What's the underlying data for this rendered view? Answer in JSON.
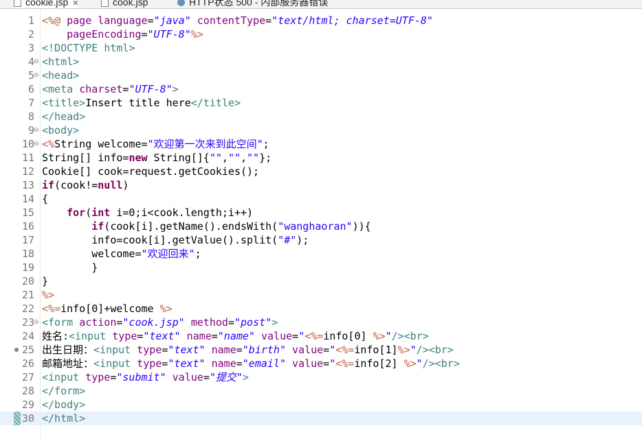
{
  "tabs": [
    {
      "label": "cookie.jsp",
      "close": "✕",
      "active": true
    },
    {
      "label": "cook.jsp",
      "close": "",
      "active": false
    },
    {
      "label": "HTTP状态 500 - 内部服务器错误",
      "close": "",
      "active": false
    }
  ],
  "editor": {
    "current_line": 30,
    "breakpoint_line": 25,
    "lines": [
      {
        "n": "1",
        "fold": "",
        "tokens": [
          [
            "dl",
            "<%@ "
          ],
          [
            "at",
            "page "
          ],
          [
            "at",
            "language"
          ],
          [
            "t",
            "="
          ],
          [
            "av",
            "\"java\""
          ],
          [
            "t",
            " "
          ],
          [
            "at",
            "contentType"
          ],
          [
            "t",
            "="
          ],
          [
            "av",
            "\"text/html; charset=UTF-8\""
          ]
        ]
      },
      {
        "n": "2",
        "fold": "",
        "tokens": [
          [
            "t",
            "    "
          ],
          [
            "at",
            "pageEncoding"
          ],
          [
            "t",
            "="
          ],
          [
            "av",
            "\"UTF-8\""
          ],
          [
            "dl",
            "%>"
          ]
        ]
      },
      {
        "n": "3",
        "fold": "",
        "tokens": [
          [
            "tg",
            "<!DOCTYPE "
          ],
          [
            "tg",
            "html"
          ],
          [
            "tg",
            ">"
          ]
        ]
      },
      {
        "n": "4",
        "fold": "⊖",
        "tokens": [
          [
            "tg",
            "<html>"
          ]
        ]
      },
      {
        "n": "5",
        "fold": "⊖",
        "tokens": [
          [
            "tg",
            "<head>"
          ]
        ]
      },
      {
        "n": "6",
        "fold": "",
        "tokens": [
          [
            "tg",
            "<meta "
          ],
          [
            "at",
            "charset"
          ],
          [
            "t",
            "="
          ],
          [
            "av",
            "\"UTF-8\""
          ],
          [
            "tg",
            ">"
          ]
        ]
      },
      {
        "n": "7",
        "fold": "",
        "tokens": [
          [
            "tg",
            "<title>"
          ],
          [
            "t",
            "Insert title here"
          ],
          [
            "tg",
            "</title>"
          ]
        ]
      },
      {
        "n": "8",
        "fold": "",
        "tokens": [
          [
            "tg",
            "</head>"
          ]
        ]
      },
      {
        "n": "9",
        "fold": "⊖",
        "tokens": [
          [
            "tg",
            "<body>"
          ]
        ]
      },
      {
        "n": "10",
        "fold": "⊖",
        "tokens": [
          [
            "dl",
            "<%"
          ],
          [
            "t",
            "String welcome="
          ],
          [
            "st",
            "\"欢迎第一次来到此空间\""
          ],
          [
            "t",
            ";"
          ]
        ]
      },
      {
        "n": "11",
        "fold": "",
        "tokens": [
          [
            "t",
            "String[] info="
          ],
          [
            "kw",
            "new"
          ],
          [
            "t",
            " String[]{"
          ],
          [
            "st",
            "\"\""
          ],
          [
            "t",
            ","
          ],
          [
            "st",
            "\"\""
          ],
          [
            "t",
            ","
          ],
          [
            "st",
            "\"\""
          ],
          [
            "t",
            "};"
          ]
        ]
      },
      {
        "n": "12",
        "fold": "",
        "tokens": [
          [
            "t",
            "Cookie[] cook=request.getCookies();"
          ]
        ]
      },
      {
        "n": "13",
        "fold": "",
        "tokens": [
          [
            "kw",
            "if"
          ],
          [
            "t",
            "(cook!="
          ],
          [
            "kw",
            "null"
          ],
          [
            "t",
            ")"
          ]
        ]
      },
      {
        "n": "14",
        "fold": "",
        "tokens": [
          [
            "t",
            "{"
          ]
        ]
      },
      {
        "n": "15",
        "fold": "",
        "tokens": [
          [
            "t",
            "    "
          ],
          [
            "kw",
            "for"
          ],
          [
            "t",
            "("
          ],
          [
            "kw",
            "int"
          ],
          [
            "t",
            " i=0;i<cook.length;i++)"
          ]
        ]
      },
      {
        "n": "16",
        "fold": "",
        "tokens": [
          [
            "t",
            "        "
          ],
          [
            "kw",
            "if"
          ],
          [
            "t",
            "(cook[i].getName().endsWith("
          ],
          [
            "st",
            "\"wanghaoran\""
          ],
          [
            "t",
            "))"
          ],
          [
            "t",
            "{"
          ]
        ]
      },
      {
        "n": "17",
        "fold": "",
        "tokens": [
          [
            "t",
            "        info=cook[i].getValue().split("
          ],
          [
            "st",
            "\"#\""
          ],
          [
            "t",
            ");"
          ]
        ]
      },
      {
        "n": "18",
        "fold": "",
        "tokens": [
          [
            "t",
            "        welcome="
          ],
          [
            "st",
            "\"欢迎回来\""
          ],
          [
            "t",
            ";"
          ]
        ]
      },
      {
        "n": "19",
        "fold": "",
        "tokens": [
          [
            "t",
            "        }"
          ]
        ]
      },
      {
        "n": "20",
        "fold": "",
        "tokens": [
          [
            "t",
            "}"
          ]
        ]
      },
      {
        "n": "21",
        "fold": "",
        "tokens": [
          [
            "dl",
            "%>"
          ]
        ]
      },
      {
        "n": "22",
        "fold": "",
        "tokens": [
          [
            "dl",
            "<%="
          ],
          [
            "t",
            "info[0]+welcome "
          ],
          [
            "dl",
            "%>"
          ]
        ]
      },
      {
        "n": "23",
        "fold": "⊖",
        "tokens": [
          [
            "tg",
            "<form "
          ],
          [
            "at",
            "action"
          ],
          [
            "t",
            "="
          ],
          [
            "av",
            "\"cook.jsp\""
          ],
          [
            "t",
            " "
          ],
          [
            "at",
            "method"
          ],
          [
            "t",
            "="
          ],
          [
            "av",
            "\"post\""
          ],
          [
            "tg",
            ">"
          ]
        ]
      },
      {
        "n": "24",
        "fold": "",
        "tokens": [
          [
            "t",
            "姓名:"
          ],
          [
            "tg",
            "<input "
          ],
          [
            "at",
            "type"
          ],
          [
            "t",
            "="
          ],
          [
            "av",
            "\"text\""
          ],
          [
            "t",
            " "
          ],
          [
            "at",
            "name"
          ],
          [
            "t",
            "="
          ],
          [
            "av",
            "\"name\""
          ],
          [
            "t",
            " "
          ],
          [
            "at",
            "value"
          ],
          [
            "t",
            "="
          ],
          [
            "av",
            "\""
          ],
          [
            "dl",
            "<%="
          ],
          [
            "t",
            "info[0] "
          ],
          [
            "dl",
            "%>"
          ],
          [
            "av",
            "\""
          ],
          [
            "tg",
            "/>"
          ],
          [
            "tg",
            "<br>"
          ]
        ]
      },
      {
        "n": "25",
        "fold": "",
        "tokens": [
          [
            "t",
            "出生日期："
          ],
          [
            "tg",
            "<input "
          ],
          [
            "at",
            "type"
          ],
          [
            "t",
            "="
          ],
          [
            "av",
            "\"text\""
          ],
          [
            "t",
            " "
          ],
          [
            "at",
            "name"
          ],
          [
            "t",
            "="
          ],
          [
            "av",
            "\"birth\""
          ],
          [
            "t",
            " "
          ],
          [
            "at",
            "value"
          ],
          [
            "t",
            "="
          ],
          [
            "av",
            "\""
          ],
          [
            "dl",
            "<%="
          ],
          [
            "t",
            "info[1]"
          ],
          [
            "dl",
            "%>"
          ],
          [
            "av",
            "\""
          ],
          [
            "tg",
            "/>"
          ],
          [
            "tg",
            "<br>"
          ]
        ]
      },
      {
        "n": "26",
        "fold": "",
        "tokens": [
          [
            "t",
            "邮箱地址："
          ],
          [
            "tg",
            "<input "
          ],
          [
            "at",
            "type"
          ],
          [
            "t",
            "="
          ],
          [
            "av",
            "\"text\""
          ],
          [
            "t",
            " "
          ],
          [
            "at",
            "name"
          ],
          [
            "t",
            "="
          ],
          [
            "av",
            "\"email\""
          ],
          [
            "t",
            " "
          ],
          [
            "at",
            "value"
          ],
          [
            "t",
            "="
          ],
          [
            "av",
            "\""
          ],
          [
            "dl",
            "<%="
          ],
          [
            "t",
            "info[2] "
          ],
          [
            "dl",
            "%>"
          ],
          [
            "av",
            "\""
          ],
          [
            "tg",
            "/>"
          ],
          [
            "tg",
            "<br>"
          ]
        ]
      },
      {
        "n": "27",
        "fold": "",
        "tokens": [
          [
            "tg",
            "<input "
          ],
          [
            "at",
            "type"
          ],
          [
            "t",
            "="
          ],
          [
            "av",
            "\"submit\""
          ],
          [
            "t",
            " "
          ],
          [
            "at",
            "value"
          ],
          [
            "t",
            "="
          ],
          [
            "av",
            "\"提交\""
          ],
          [
            "tg",
            ">"
          ]
        ]
      },
      {
        "n": "28",
        "fold": "",
        "tokens": [
          [
            "tg",
            "</form>"
          ]
        ]
      },
      {
        "n": "29",
        "fold": "",
        "tokens": [
          [
            "tg",
            "</body>"
          ]
        ]
      },
      {
        "n": "30",
        "fold": "",
        "tokens": [
          [
            "tg",
            "</html>"
          ]
        ]
      }
    ]
  }
}
